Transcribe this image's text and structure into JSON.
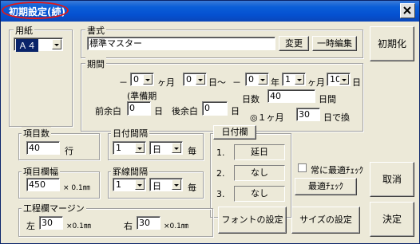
{
  "window": {
    "title": "初期設定(続)"
  },
  "paper": {
    "group_label": "用紙",
    "size_value": "Ａ４"
  },
  "format": {
    "group_label": "書式",
    "name_value": "標準マスター",
    "change_label": "変更",
    "temp_edit_label": "一時編集"
  },
  "init_button": "初期化",
  "period": {
    "group_label": "期間",
    "dash": "－",
    "start_months": "0",
    "months_unit": "ヶ月",
    "start_days": "0",
    "days_unit": "日～",
    "dash2": "－",
    "end_years": "0",
    "years_unit": "年",
    "end_months": "1",
    "end_months_unit": "ヶ月",
    "end_days": "10",
    "end_days_unit": "日",
    "prep_label": "(準備期",
    "days_count_label": "日数",
    "days_count_value": "40",
    "days_count_unit": "日間",
    "before_margin_label": "前余白",
    "before_margin_value": "0",
    "before_margin_unit": "日",
    "after_margin_label": "後余白",
    "after_margin_value": "0",
    "after_margin_unit": "日",
    "conversion_prefix": "◎１ヶ月",
    "conversion_value": "30",
    "conversion_suffix": "日で換"
  },
  "items": {
    "group_label": "項目数",
    "value": "40",
    "unit": "行"
  },
  "date_interval": {
    "group_label": "日付間隔",
    "value": "1",
    "unit_value": "日",
    "suffix": "毎"
  },
  "date_column": {
    "group_label": "日付欄",
    "rows": [
      {
        "num": "1.",
        "value": "延日"
      },
      {
        "num": "2.",
        "value": "なし"
      },
      {
        "num": "3.",
        "value": "なし"
      }
    ]
  },
  "auto_fit": {
    "checkbox_label": "常に最適ﾁｪｯｸ",
    "button_label": "最適ﾁｪｯｸ"
  },
  "cancel_button": "取消",
  "item_width": {
    "group_label": "項目欄幅",
    "value": "450",
    "unit": "× 0.1㎜"
  },
  "ruled_interval": {
    "group_label": "罫線間隔",
    "value": "1",
    "unit_value": "日",
    "suffix": "毎"
  },
  "margin": {
    "group_label": "工程欄マージン",
    "left_label": "左",
    "left_value": "30",
    "left_unit": "×0.1㎜",
    "right_label": "右",
    "right_value": "30",
    "right_unit": "×0.1㎜"
  },
  "font_button": "フォントの設定",
  "size_button": "サイズの設定",
  "ok_button": "決定"
}
